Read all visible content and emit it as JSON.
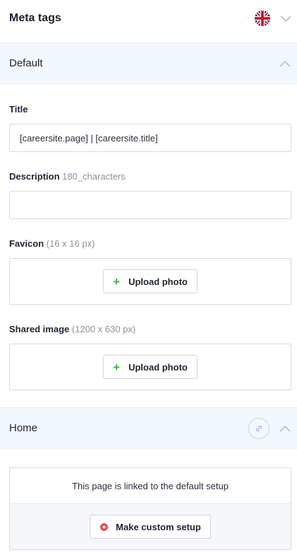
{
  "header": {
    "title": "Meta tags",
    "language_flag_icon": "uk-flag-icon",
    "toggle_icon": "chevron-down-icon"
  },
  "default_section": {
    "label": "Default",
    "title_field": {
      "label": "Title",
      "value": "[careersite.page] | [careersite.title]"
    },
    "description_field": {
      "label": "Description",
      "hint": "180_characters",
      "value": ""
    },
    "favicon": {
      "label": "Favicon",
      "hint": "(16 x 16 px)",
      "button_label": "Upload photo"
    },
    "shared_image": {
      "label": "Shared image",
      "hint": "(1200 x 630 px)",
      "button_label": "Upload photo"
    }
  },
  "home_section": {
    "label": "Home",
    "linked_message": "This page is linked to the default setup",
    "custom_button_label": "Make custom setup"
  },
  "colors": {
    "accent_green": "#3cb54a",
    "accent_red": "#e8404a",
    "section_bg": "#f3f8fd"
  }
}
